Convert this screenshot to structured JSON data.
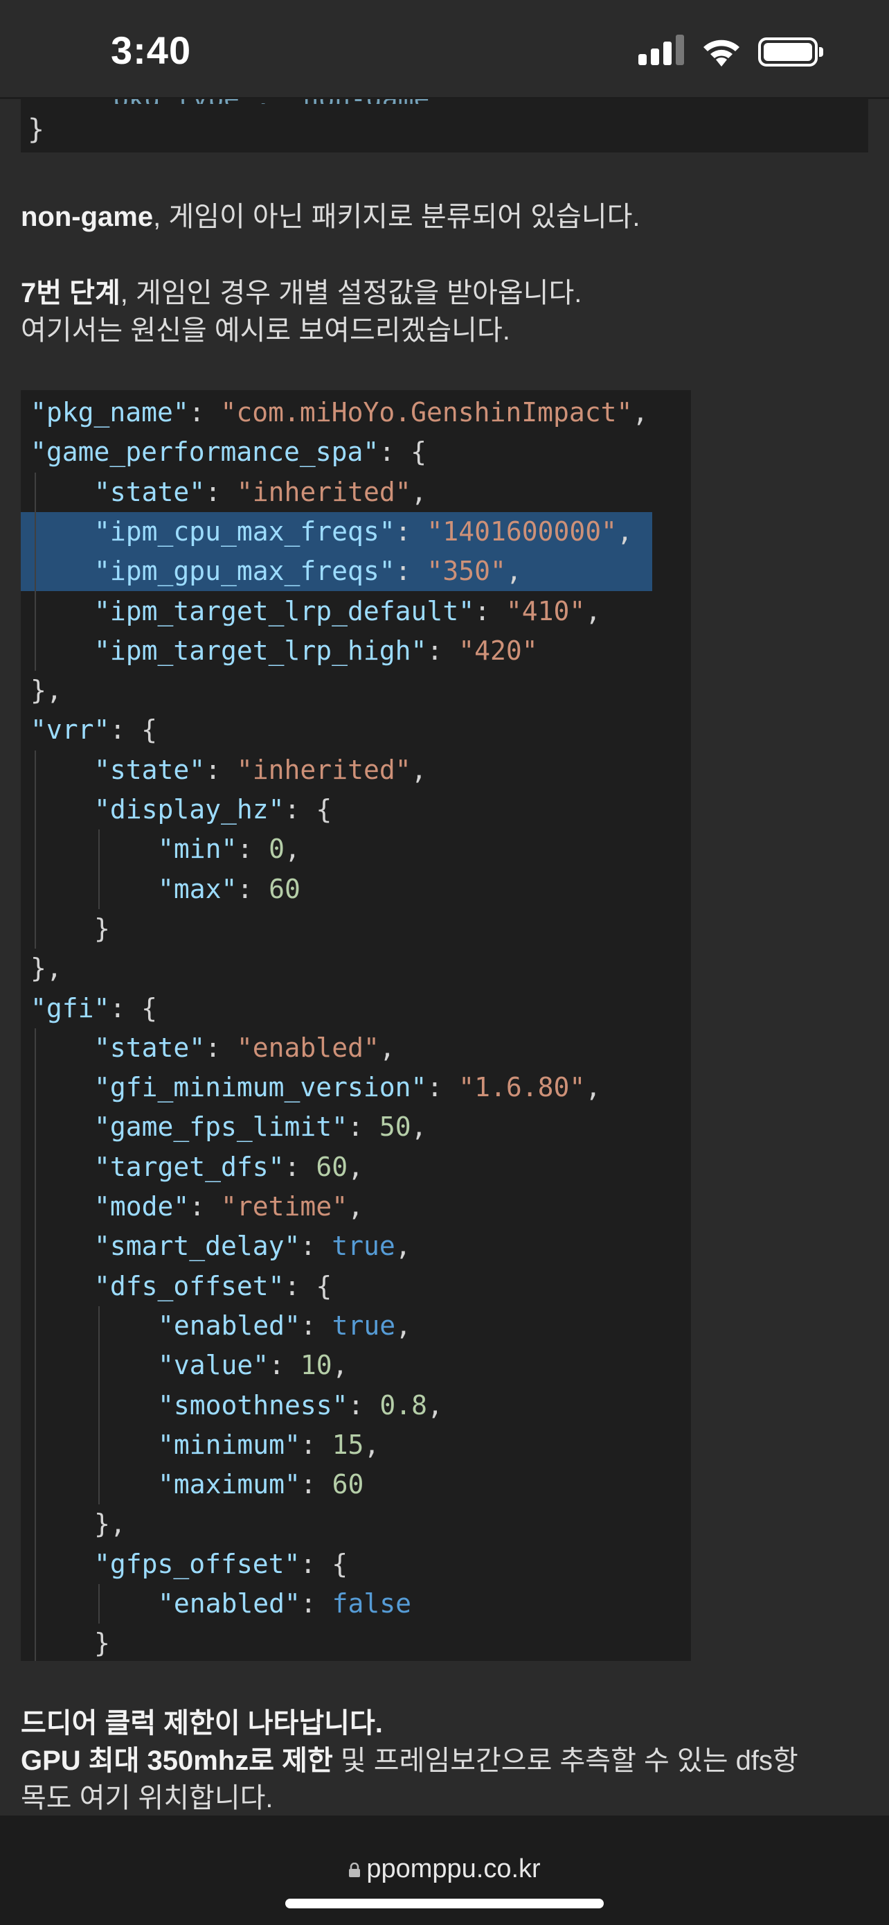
{
  "status_bar": {
    "time": "3:40"
  },
  "top_code": {
    "partial_line": "\"pkg_type\": \"non-game\"",
    "closing_brace": "}"
  },
  "paragraphs": {
    "p1_bold": "non-game",
    "p1_rest": ", 게임이 아닌 패키지로 분류되어 있습니다.",
    "p2_bold": "7번 단계",
    "p2_rest": ", 게임인 경우 개별 설정값을 받아옵니다.",
    "p3": "여기서는 원신을 예시로 보여드리겠습니다.",
    "p4_bold": "드디어 클럭 제한이 나타납니다.",
    "p5_bold": "GPU 최대 350mhz로 제한",
    "p5_rest": " 및 프레임보간으로 추측할 수 있는 dfs항",
    "p6": "목도 여기 위치합니다."
  },
  "code_lines": [
    {
      "indent": 0,
      "key": "\"pkg_name\"",
      "value": "\"com.miHoYo.GenshinImpact\"",
      "vtype": "s",
      "trail": ",",
      "highlight": false
    },
    {
      "indent": 0,
      "key": "\"game_performance_spa\"",
      "value": "{",
      "vtype": "p",
      "trail": "",
      "highlight": false
    },
    {
      "indent": 1,
      "key": "\"state\"",
      "value": "\"inherited\"",
      "vtype": "s",
      "trail": ",",
      "highlight": false
    },
    {
      "indent": 1,
      "key": "\"ipm_cpu_max_freqs\"",
      "value": "\"1401600000\"",
      "vtype": "s",
      "trail": ",",
      "highlight": true
    },
    {
      "indent": 1,
      "key": "\"ipm_gpu_max_freqs\"",
      "value": "\"350\"",
      "vtype": "s",
      "trail": ",",
      "highlight": true
    },
    {
      "indent": 1,
      "key": "\"ipm_target_lrp_default\"",
      "value": "\"410\"",
      "vtype": "s",
      "trail": ",",
      "highlight": false
    },
    {
      "indent": 1,
      "key": "\"ipm_target_lrp_high\"",
      "value": "\"420\"",
      "vtype": "s",
      "trail": "",
      "highlight": false
    },
    {
      "indent": 0,
      "key": "",
      "value": "},",
      "vtype": "p",
      "trail": "",
      "highlight": false
    },
    {
      "indent": 0,
      "key": "\"vrr\"",
      "value": "{",
      "vtype": "p",
      "trail": "",
      "highlight": false
    },
    {
      "indent": 1,
      "key": "\"state\"",
      "value": "\"inherited\"",
      "vtype": "s",
      "trail": ",",
      "highlight": false
    },
    {
      "indent": 1,
      "key": "\"display_hz\"",
      "value": "{",
      "vtype": "p",
      "trail": "",
      "highlight": false
    },
    {
      "indent": 2,
      "key": "\"min\"",
      "value": "0",
      "vtype": "n",
      "trail": ",",
      "highlight": false
    },
    {
      "indent": 2,
      "key": "\"max\"",
      "value": "60",
      "vtype": "n",
      "trail": "",
      "highlight": false
    },
    {
      "indent": 1,
      "key": "",
      "value": "}",
      "vtype": "p",
      "trail": "",
      "highlight": false
    },
    {
      "indent": 0,
      "key": "",
      "value": "},",
      "vtype": "p",
      "trail": "",
      "highlight": false
    },
    {
      "indent": 0,
      "key": "\"gfi\"",
      "value": "{",
      "vtype": "p",
      "trail": "",
      "highlight": false
    },
    {
      "indent": 1,
      "key": "\"state\"",
      "value": "\"enabled\"",
      "vtype": "s",
      "trail": ",",
      "highlight": false
    },
    {
      "indent": 1,
      "key": "\"gfi_minimum_version\"",
      "value": "\"1.6.80\"",
      "vtype": "s",
      "trail": ",",
      "highlight": false
    },
    {
      "indent": 1,
      "key": "\"game_fps_limit\"",
      "value": "50",
      "vtype": "n",
      "trail": ",",
      "highlight": false
    },
    {
      "indent": 1,
      "key": "\"target_dfs\"",
      "value": "60",
      "vtype": "n",
      "trail": ",",
      "highlight": false
    },
    {
      "indent": 1,
      "key": "\"mode\"",
      "value": "\"retime\"",
      "vtype": "s",
      "trail": ",",
      "highlight": false
    },
    {
      "indent": 1,
      "key": "\"smart_delay\"",
      "value": "true",
      "vtype": "b",
      "trail": ",",
      "highlight": false
    },
    {
      "indent": 1,
      "key": "\"dfs_offset\"",
      "value": "{",
      "vtype": "p",
      "trail": "",
      "highlight": false
    },
    {
      "indent": 2,
      "key": "\"enabled\"",
      "value": "true",
      "vtype": "b",
      "trail": ",",
      "highlight": false
    },
    {
      "indent": 2,
      "key": "\"value\"",
      "value": "10",
      "vtype": "n",
      "trail": ",",
      "highlight": false
    },
    {
      "indent": 2,
      "key": "\"smoothness\"",
      "value": "0.8",
      "vtype": "n",
      "trail": ",",
      "highlight": false
    },
    {
      "indent": 2,
      "key": "\"minimum\"",
      "value": "15",
      "vtype": "n",
      "trail": ",",
      "highlight": false
    },
    {
      "indent": 2,
      "key": "\"maximum\"",
      "value": "60",
      "vtype": "n",
      "trail": "",
      "highlight": false
    },
    {
      "indent": 1,
      "key": "",
      "value": "},",
      "vtype": "p",
      "trail": "",
      "highlight": false
    },
    {
      "indent": 1,
      "key": "\"gfps_offset\"",
      "value": "{",
      "vtype": "p",
      "trail": "",
      "highlight": false
    },
    {
      "indent": 2,
      "key": "\"enabled\"",
      "value": "false",
      "vtype": "b",
      "trail": "",
      "highlight": false
    },
    {
      "indent": 1,
      "key": "",
      "value": "}",
      "vtype": "p",
      "trail": "",
      "highlight": false
    }
  ],
  "bottom_bar": {
    "url": "ppomppu.co.kr"
  }
}
